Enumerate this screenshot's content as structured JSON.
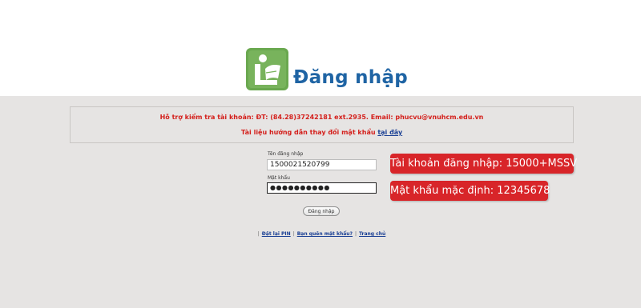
{
  "header": {
    "title": "Đăng nhập"
  },
  "notice": {
    "support_text": "Hỗ trợ kiểm tra tài khoản: ĐT: (84.28)37242181 ext.2935. Email: phucvu@vnuhcm.edu.vn",
    "guide_text": "Tài liệu hướng dẫn thay đổi mật khẩu ",
    "guide_link": "tại đây"
  },
  "form": {
    "username_label": "Tên đăng nhập",
    "username_value": "1500021520799",
    "password_label": "Mật khẩu",
    "password_value": "●●●●●●●●●●",
    "login_button": "Đăng nhập"
  },
  "links": {
    "reset_pin": "Đặt lại PIN",
    "forgot_password": "Bạn quên mật khẩu?",
    "home": "Trang chủ"
  },
  "badges": {
    "account": "Tài khoản đăng nhập: 15000+MSSV",
    "password": "Mật khẩu mặc định: 12345678"
  },
  "colors": {
    "title_blue": "#1f64a4",
    "notice_red": "#d4201c",
    "badge_red": "#d82529",
    "logo_green": "#6aa84f",
    "background_gray": "#e6e4e3"
  }
}
